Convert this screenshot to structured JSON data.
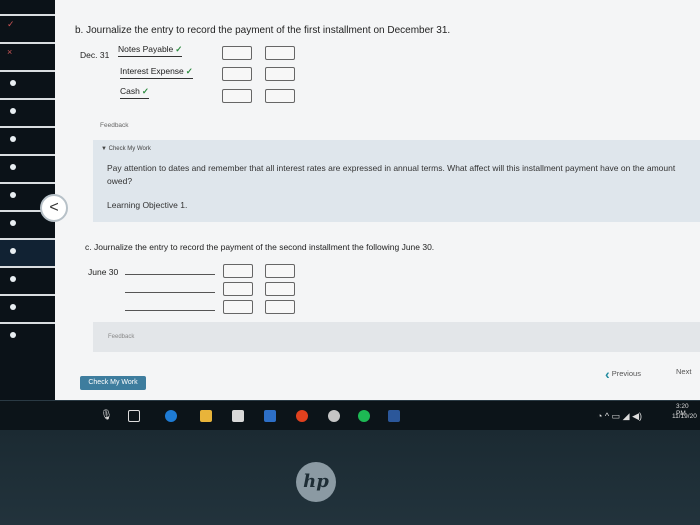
{
  "part_b": {
    "title": "b. Journalize the entry to record the payment of the first installment on December 31.",
    "date": "Dec. 31",
    "accounts": [
      {
        "name": "Notes Payable",
        "check": "✓"
      },
      {
        "name": "Interest Expense",
        "check": "✓"
      },
      {
        "name": "Cash",
        "check": "✓"
      }
    ]
  },
  "feedback_label": "Feedback",
  "feedback_panel": {
    "heading": "▼ Check My Work",
    "text": "Pay attention to dates and remember that all interest rates are expressed in annual terms. What affect will this installment payment have on the amount owed?",
    "objective": "Learning Objective 1."
  },
  "back_button": "<",
  "part_c": {
    "title": "c. Journalize the entry to record the payment of the second installment the following June 30.",
    "date": "June 30"
  },
  "feedback_label_2": "Feedback",
  "check_my_work_button": "Check My Work",
  "previous_label": "Previous",
  "next_label": "Next",
  "taskbar": {
    "time": "3:20 PM",
    "date": "11/19/20"
  },
  "brand": "hp"
}
